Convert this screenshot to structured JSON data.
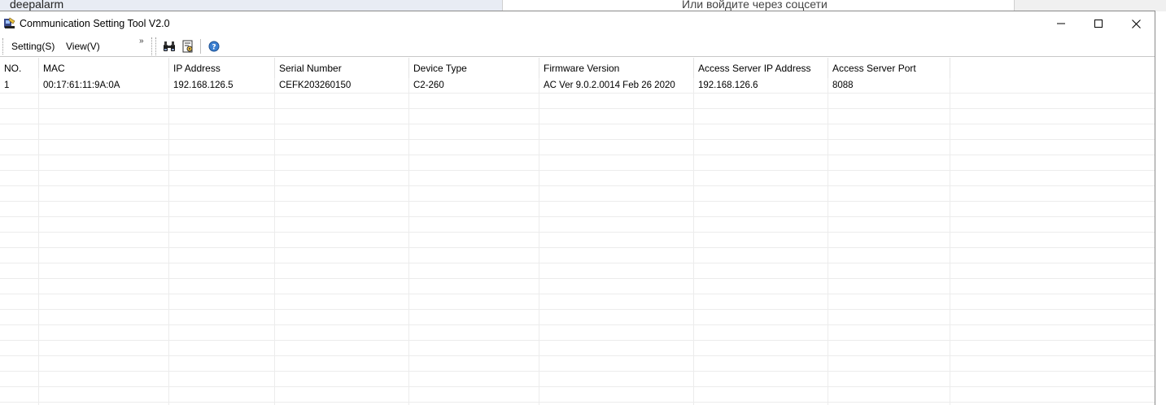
{
  "background": {
    "left_text": "deepalarm",
    "mid_text": "Или войдите через соцсети"
  },
  "window": {
    "title": "Communication Setting Tool V2.0"
  },
  "menu": {
    "setting": "Setting(S)",
    "view": "View(V)",
    "overflow": "»"
  },
  "grid": {
    "columns": [
      "NO.",
      "MAC",
      "IP Address",
      "Serial Number",
      "Device Type",
      "Firmware Version",
      "Access Server IP Address",
      "Access Server Port"
    ],
    "rows": [
      [
        "1",
        "00:17:61:11:9A:0A",
        "192.168.126.5",
        "CEFK203260150",
        "C2-260",
        "AC Ver 9.0.2.0014 Feb 26 2020",
        "192.168.126.6",
        "8088"
      ]
    ]
  }
}
